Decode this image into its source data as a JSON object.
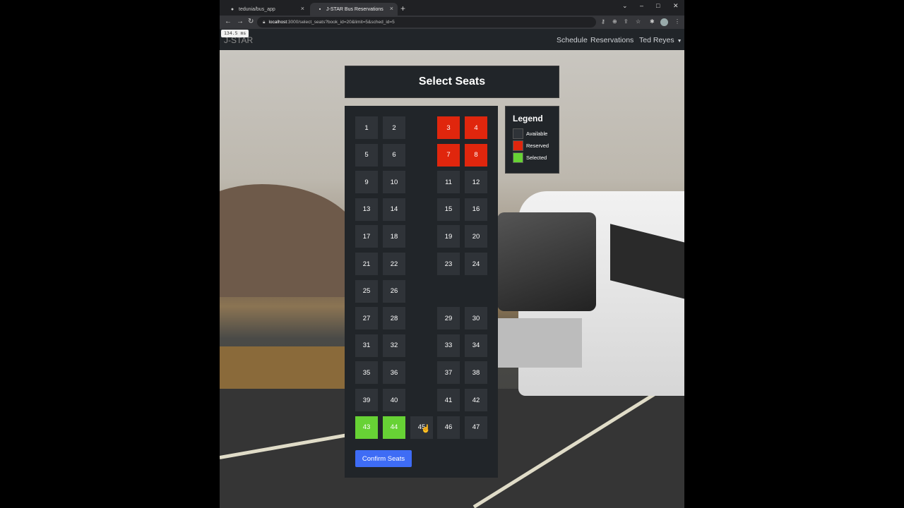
{
  "browser": {
    "tabs": [
      {
        "label": "tedunia/bus_app",
        "icon": "github-icon"
      },
      {
        "label": "J-STAR Bus Reservations",
        "icon": "page-icon"
      }
    ],
    "url_host": "localhost",
    "url_path": ":3000/select_seats?book_id=20&limit=5&sched_id=5",
    "timing_badge": "134.5 ms"
  },
  "nav": {
    "brand": "J-STAR",
    "links": [
      "Schedule",
      "Reservations"
    ],
    "user": "Ted Reyes"
  },
  "page": {
    "title": "Select Seats",
    "confirm_label": "Confirm Seats"
  },
  "legend": {
    "title": "Legend",
    "items": [
      {
        "label": "Available",
        "color": "#2f3338"
      },
      {
        "label": "Reserved",
        "color": "#e0260d"
      },
      {
        "label": "Selected",
        "color": "#67d235"
      }
    ]
  },
  "seats": [
    {
      "n": "1",
      "status": "available"
    },
    {
      "n": "2",
      "status": "available"
    },
    {
      "n": "3",
      "status": "reserved"
    },
    {
      "n": "4",
      "status": "reserved"
    },
    {
      "n": "5",
      "status": "available"
    },
    {
      "n": "6",
      "status": "available"
    },
    {
      "n": "7",
      "status": "reserved"
    },
    {
      "n": "8",
      "status": "reserved"
    },
    {
      "n": "9",
      "status": "available"
    },
    {
      "n": "10",
      "status": "available"
    },
    {
      "n": "11",
      "status": "available"
    },
    {
      "n": "12",
      "status": "available"
    },
    {
      "n": "13",
      "status": "available"
    },
    {
      "n": "14",
      "status": "available"
    },
    {
      "n": "15",
      "status": "available"
    },
    {
      "n": "16",
      "status": "available"
    },
    {
      "n": "17",
      "status": "available"
    },
    {
      "n": "18",
      "status": "available"
    },
    {
      "n": "19",
      "status": "available"
    },
    {
      "n": "20",
      "status": "available"
    },
    {
      "n": "21",
      "status": "available"
    },
    {
      "n": "22",
      "status": "available"
    },
    {
      "n": "23",
      "status": "available"
    },
    {
      "n": "24",
      "status": "available"
    },
    {
      "n": "25",
      "status": "available"
    },
    {
      "n": "26",
      "status": "available"
    },
    {
      "n": "27",
      "status": "available"
    },
    {
      "n": "28",
      "status": "available"
    },
    {
      "n": "29",
      "status": "available"
    },
    {
      "n": "30",
      "status": "available"
    },
    {
      "n": "31",
      "status": "available"
    },
    {
      "n": "32",
      "status": "available"
    },
    {
      "n": "33",
      "status": "available"
    },
    {
      "n": "34",
      "status": "available"
    },
    {
      "n": "35",
      "status": "available"
    },
    {
      "n": "36",
      "status": "available"
    },
    {
      "n": "37",
      "status": "available"
    },
    {
      "n": "38",
      "status": "available"
    },
    {
      "n": "39",
      "status": "available"
    },
    {
      "n": "40",
      "status": "available"
    },
    {
      "n": "41",
      "status": "available"
    },
    {
      "n": "42",
      "status": "available"
    },
    {
      "n": "43",
      "status": "selected"
    },
    {
      "n": "44",
      "status": "selected"
    },
    {
      "n": "45",
      "status": "available"
    },
    {
      "n": "46",
      "status": "available"
    },
    {
      "n": "47",
      "status": "available"
    }
  ]
}
